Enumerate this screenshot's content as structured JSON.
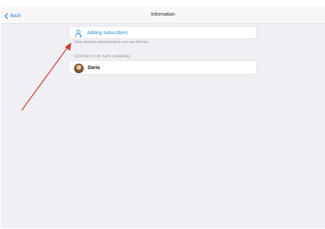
{
  "colors": {
    "accent": "#2a84d8",
    "background": "#efeff4",
    "annotation_arrow": "#d63a2f"
  },
  "navbar": {
    "back_label": "Back",
    "back_icon": "chevron-left-icon",
    "title": "Information"
  },
  "adding": {
    "icon": "person-add-icon",
    "label": "Adding subscribers",
    "hint": "Only channel administrators can see this list."
  },
  "contacts": {
    "section_title": "CONTACTS IN THIS CHANNEL",
    "items": [
      {
        "name": "Daria",
        "avatar": "user-avatar-photo"
      }
    ]
  }
}
